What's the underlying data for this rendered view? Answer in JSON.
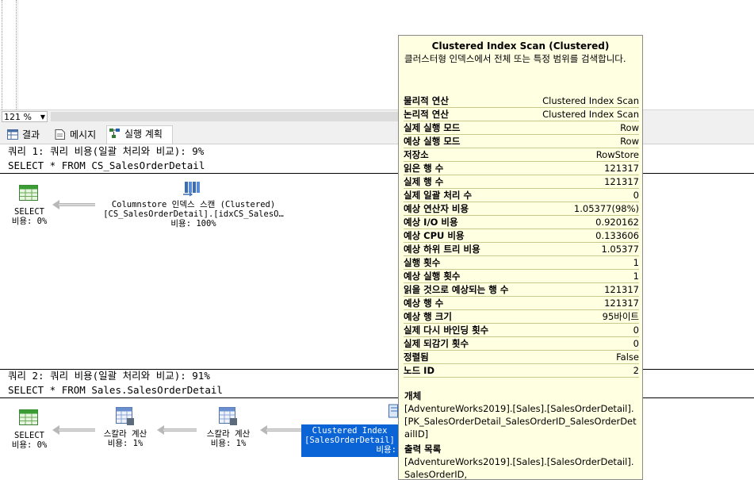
{
  "zoom": {
    "value": "121 %"
  },
  "tabs": [
    {
      "label": "결과"
    },
    {
      "label": "메시지"
    },
    {
      "label": "실행 계획"
    }
  ],
  "query1": {
    "header": "쿼리 1: 쿼리 비용(일괄 처리와 비교): 9%",
    "sql": "SELECT * FROM CS_SalesOrderDetail",
    "select_op": {
      "name": "SELECT",
      "cost": "비용: 0%"
    },
    "scan_op": {
      "line1": "Columnstore 인덱스 스캔 (Clustered)",
      "line2": "[CS_SalesOrderDetail].[idxCS_SalesO…",
      "cost": "비용: 100%"
    }
  },
  "query2": {
    "header": "쿼리 2: 쿼리 비용(일괄 처리와 비교): 91%",
    "sql": "SELECT * FROM Sales.SalesOrderDetail",
    "select_op": {
      "name": "SELECT",
      "cost": "비용: 0%"
    },
    "scalar1": {
      "name": "스칼라 계산",
      "cost": "비용: 1%"
    },
    "scalar2": {
      "name": "스칼라 계산",
      "cost": "비용: 1%"
    },
    "index_op": {
      "line1": "Clustered Index",
      "line2": "[SalesOrderDetail]",
      "cost": "비용:"
    }
  },
  "tooltip": {
    "title": "Clustered Index Scan (Clustered)",
    "description": "클러스터형 인덱스에서 전체 또는 특정 범위를 검색합니다.",
    "rows": [
      {
        "k": "물리적 연산",
        "v": "Clustered Index Scan"
      },
      {
        "k": "논리적 연산",
        "v": "Clustered Index Scan"
      },
      {
        "k": "실제 실행 모드",
        "v": "Row"
      },
      {
        "k": "예상 실행 모드",
        "v": "Row"
      },
      {
        "k": "저장소",
        "v": "RowStore"
      },
      {
        "k": "읽은 행 수",
        "v": "121317"
      },
      {
        "k": "실제 행 수",
        "v": "121317"
      },
      {
        "k": "실제 일괄 처리 수",
        "v": "0"
      },
      {
        "k": "예상 연산자 비용",
        "v": "1.05377(98%)"
      },
      {
        "k": "예상 I/O 비용",
        "v": "0.920162"
      },
      {
        "k": "예상 CPU 비용",
        "v": "0.133606"
      },
      {
        "k": "예상 하위 트리 비용",
        "v": "1.05377"
      },
      {
        "k": "실행 횟수",
        "v": "1"
      },
      {
        "k": "예상 실행 횟수",
        "v": "1"
      },
      {
        "k": "읽을 것으로 예상되는 행 수",
        "v": "121317"
      },
      {
        "k": "예상 행 수",
        "v": "121317"
      },
      {
        "k": "예상 행 크기",
        "v": "95바이트"
      },
      {
        "k": "실제 다시 바인딩 횟수",
        "v": "0"
      },
      {
        "k": "실제 되감기 횟수",
        "v": "0"
      },
      {
        "k": "정렬됨",
        "v": "False"
      },
      {
        "k": "노드 ID",
        "v": "2"
      }
    ],
    "object_label": "개체",
    "object_value": "[AdventureWorks2019].[Sales].[SalesOrderDetail].[PK_SalesOrderDetail_SalesOrderID_SalesOrderDetailID]",
    "output_label": "출력 목록",
    "output_value": "[AdventureWorks2019].[Sales].[SalesOrderDetail].SalesOrderID,"
  }
}
